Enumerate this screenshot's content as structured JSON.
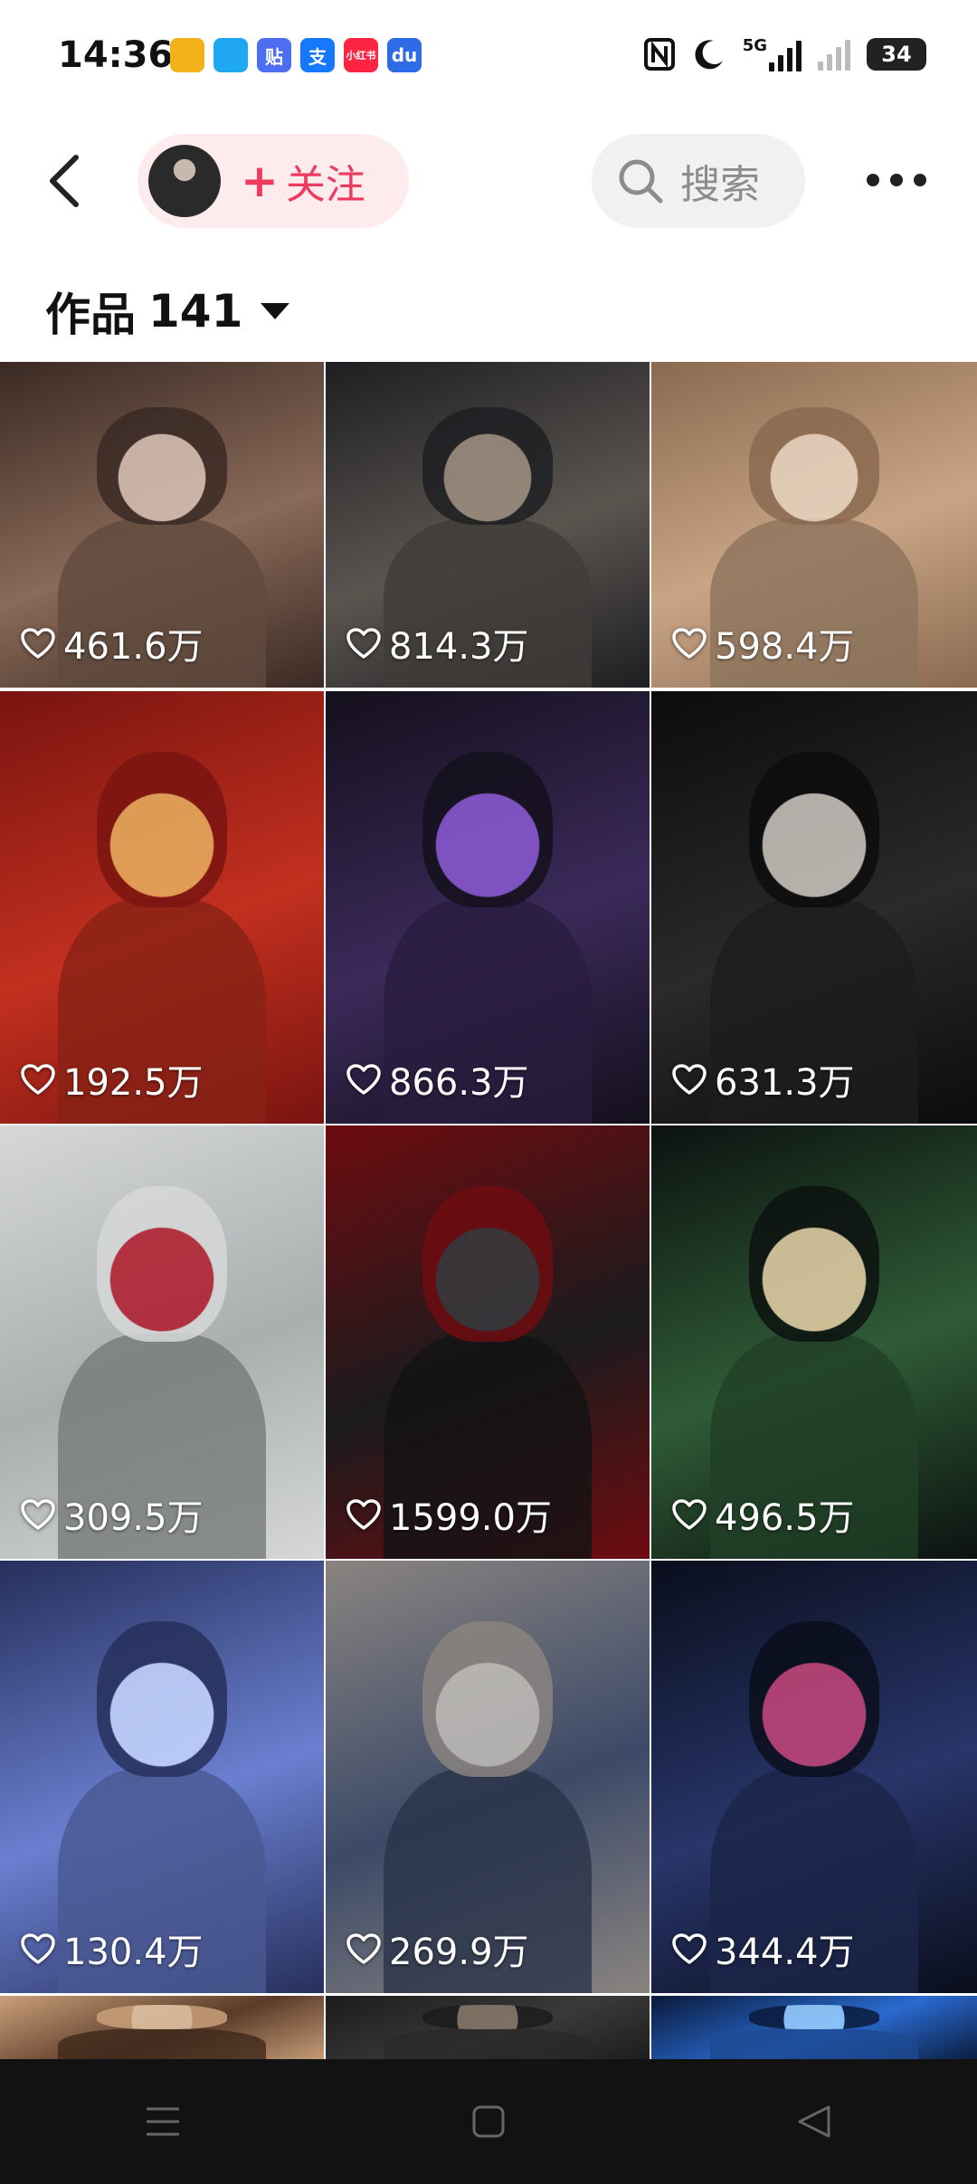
{
  "status_bar": {
    "time": "14:36",
    "app_icons": [
      {
        "name": "weibo-icon",
        "text": "",
        "color": "#f3b21a"
      },
      {
        "name": "play-icon",
        "text": "",
        "color": "#1fa7f2"
      },
      {
        "name": "tieba-icon",
        "text": "贴",
        "color": "#4e6ef2"
      },
      {
        "name": "alipay-icon",
        "text": "支",
        "color": "#1677ff"
      },
      {
        "name": "xiaohongshu-icon",
        "text": "小红书",
        "color": "#ff2442"
      },
      {
        "name": "baidu-icon",
        "text": "du",
        "color": "#2e6be6"
      }
    ],
    "network": "5G",
    "battery": "34"
  },
  "header": {
    "follow_label": "关注",
    "search_placeholder": "搜索"
  },
  "works": {
    "label": "作品",
    "count": "141"
  },
  "tiles": [
    {
      "likes": "461.6万",
      "tone": [
        "#3a2a24",
        "#8a6a58",
        "#d8c2b5"
      ]
    },
    {
      "likes": "814.3万",
      "tone": [
        "#1e1f22",
        "#5b5550",
        "#9e9080"
      ]
    },
    {
      "likes": "598.4万",
      "tone": [
        "#8a6a50",
        "#c9a585",
        "#e6d3bf"
      ]
    },
    {
      "likes": "192.5万",
      "tone": [
        "#7a1410",
        "#c2301f",
        "#e8b060"
      ]
    },
    {
      "likes": "866.3万",
      "tone": [
        "#14101c",
        "#3b2a5a",
        "#8c5ad6"
      ]
    },
    {
      "likes": "631.3万",
      "tone": [
        "#0c0c0c",
        "#2a2a2a",
        "#cfc8c2"
      ]
    },
    {
      "likes": "309.5万",
      "tone": [
        "#d6d8d8",
        "#a9aeae",
        "#b0192a"
      ]
    },
    {
      "likes": "1599.0万",
      "tone": [
        "#6e0c10",
        "#1b1b1d",
        "#3a3a3e"
      ]
    },
    {
      "likes": "496.5万",
      "tone": [
        "#0c1210",
        "#2f5c36",
        "#e8d2a8"
      ]
    },
    {
      "likes": "130.4万",
      "tone": [
        "#26305c",
        "#6a7fd0",
        "#c8d8ff"
      ]
    },
    {
      "likes": "269.9万",
      "tone": [
        "#8a8480",
        "#3c4a68",
        "#c4c0ba"
      ]
    },
    {
      "likes": "344.4万",
      "tone": [
        "#0a0e1c",
        "#28366a",
        "#c8467a"
      ]
    },
    {
      "likes": "",
      "tone": [
        "#c9a07a",
        "#5a3a28",
        "#e6c9a8"
      ]
    },
    {
      "likes": "",
      "tone": [
        "#1c1c1c",
        "#3a3a3a",
        "#8a7a6a"
      ]
    },
    {
      "likes": "",
      "tone": [
        "#0a1a3a",
        "#2a6ad0",
        "#9ad0ff"
      ]
    }
  ]
}
